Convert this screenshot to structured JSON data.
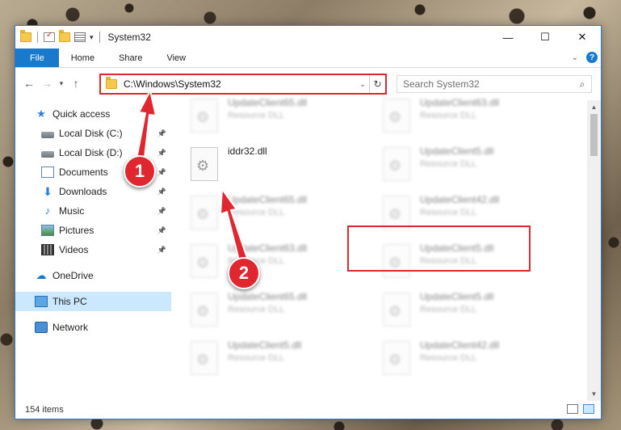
{
  "window": {
    "title": "System32",
    "controls": {
      "minimize": "—",
      "maximize": "☐",
      "close": "✕"
    }
  },
  "ribbon": {
    "tabs": [
      "File",
      "Home",
      "Share",
      "View"
    ]
  },
  "address": {
    "path": "C:\\Windows\\System32",
    "search_placeholder": "Search System32"
  },
  "nav": {
    "quick_access": "Quick access",
    "items": [
      {
        "label": "Local Disk (C:)",
        "icon": "drive-icon",
        "pinned": true
      },
      {
        "label": "Local Disk (D:)",
        "icon": "drive-icon",
        "pinned": true
      },
      {
        "label": "Documents",
        "icon": "documents-icon",
        "pinned": true
      },
      {
        "label": "Downloads",
        "icon": "downloads-icon",
        "pinned": true
      },
      {
        "label": "Music",
        "icon": "music-icon",
        "pinned": true
      },
      {
        "label": "Pictures",
        "icon": "pictures-icon",
        "pinned": true
      },
      {
        "label": "Videos",
        "icon": "videos-icon",
        "pinned": true
      }
    ],
    "onedrive": "OneDrive",
    "this_pc": "This PC",
    "network": "Network"
  },
  "files": {
    "left": [
      {
        "name": "UpdateClient65.dll",
        "type": "Resource DLL",
        "blurred": true
      },
      {
        "name": "iddr32.dll",
        "type": "",
        "blurred": false
      },
      {
        "name": "UpdateClient65.dll",
        "type": "Resource DLL",
        "blurred": true
      },
      {
        "name": "UpdateClient63.dll",
        "type": "Resource DLL",
        "blurred": true
      },
      {
        "name": "UpdateClient65.dll",
        "type": "Resource DLL",
        "blurred": true
      },
      {
        "name": "UpdateClient5.dll",
        "type": "Resource DLL",
        "blurred": true
      }
    ],
    "right": [
      {
        "name": "UpdateClient63.dll",
        "type": "Resource DLL",
        "blurred": true
      },
      {
        "name": "UpdateClient5.dll",
        "type": "Resource DLL",
        "blurred": true
      },
      {
        "name": "UpdateClient42.dll",
        "type": "Resource DLL",
        "blurred": true
      },
      {
        "name": "UpdateClient5.dll",
        "type": "Resource DLL",
        "blurred": true
      },
      {
        "name": "UpdateClient5.dll",
        "type": "Resource DLL",
        "blurred": true
      },
      {
        "name": "UpdateClient42.dll",
        "type": "Resource DLL",
        "blurred": true
      }
    ]
  },
  "status": {
    "item_count": "154 items"
  },
  "callouts": {
    "step1": "1",
    "step2": "2"
  },
  "colors": {
    "accent": "#1979ca",
    "highlight": "#e0262f",
    "selection": "#cce8ff"
  }
}
